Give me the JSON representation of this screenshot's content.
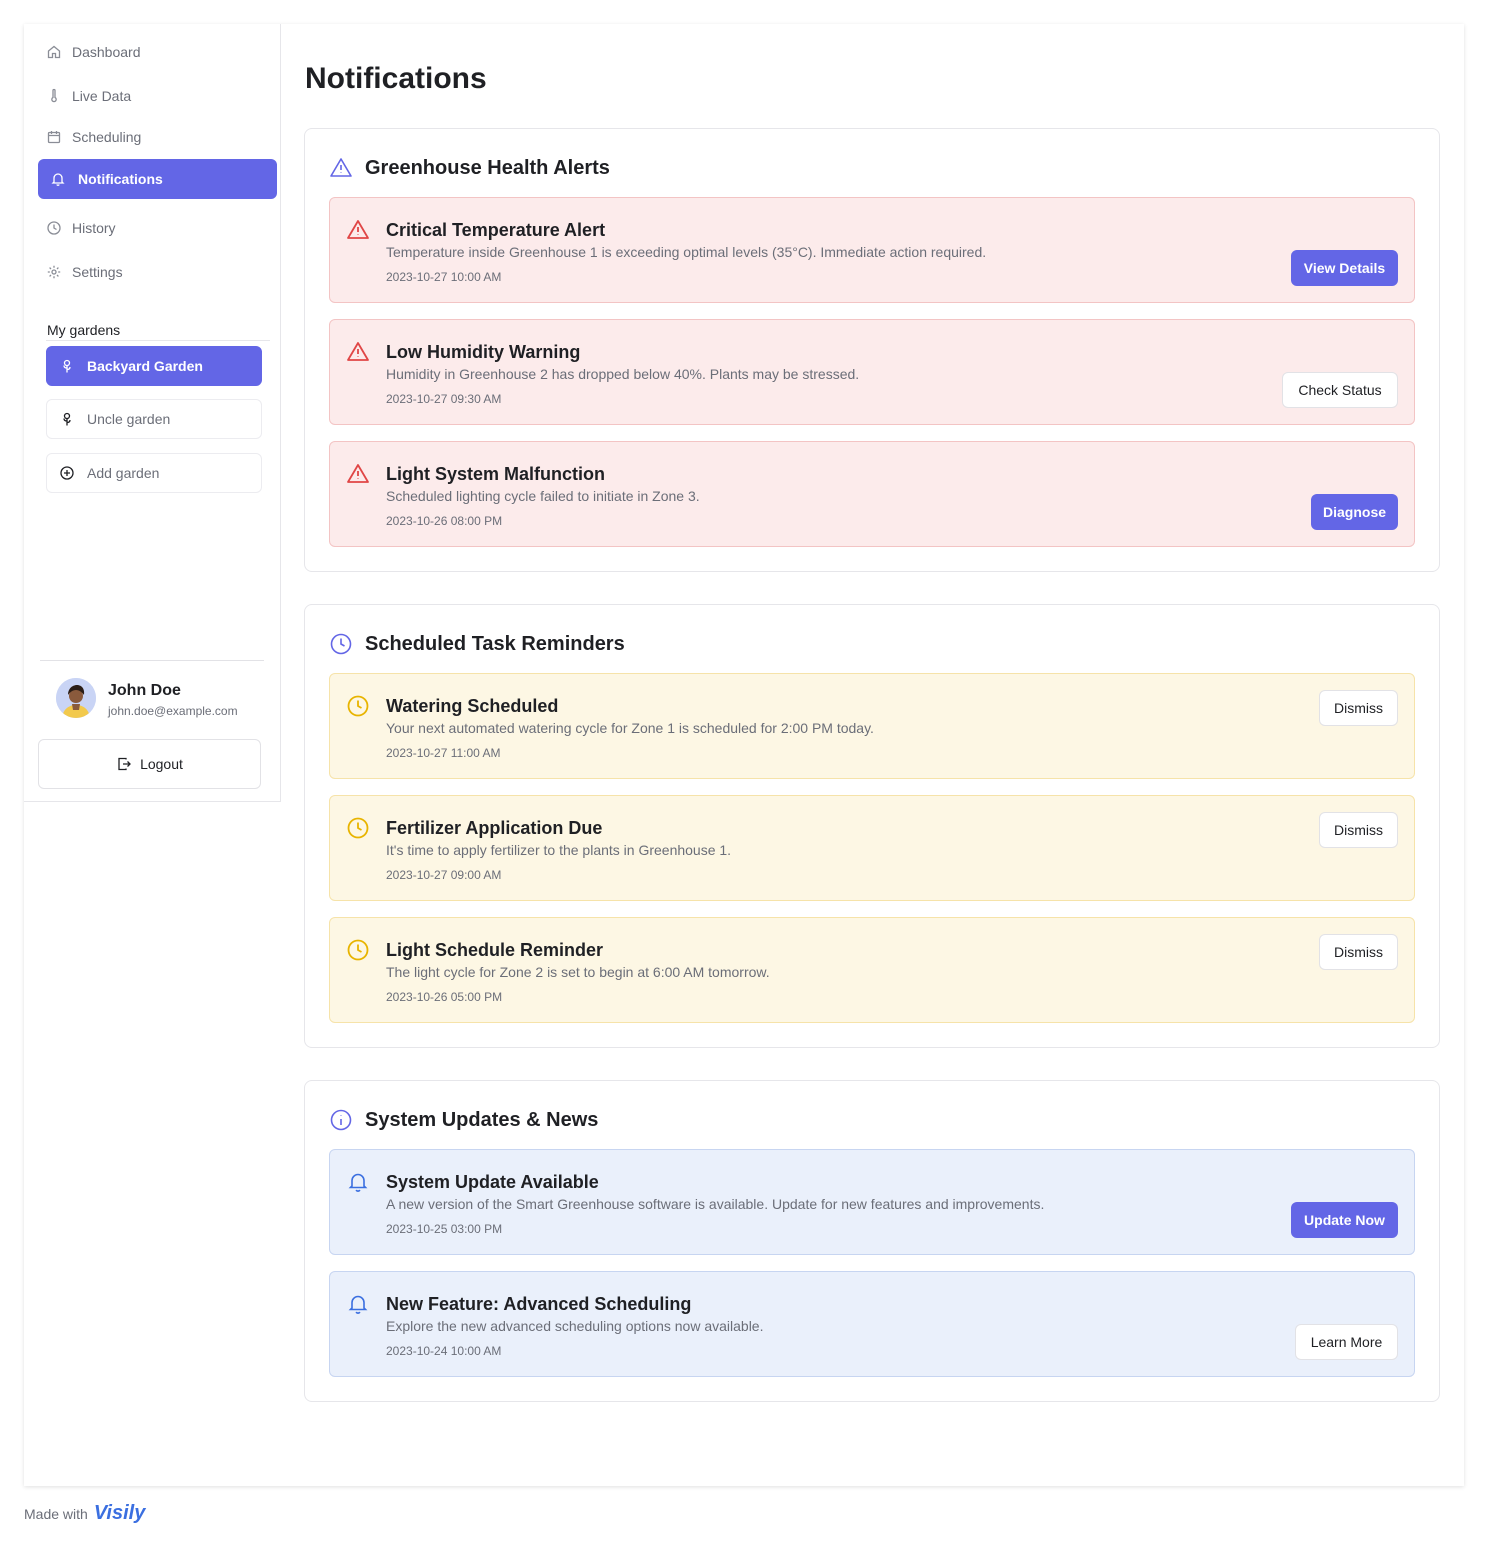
{
  "nav": {
    "dashboard": "Dashboard",
    "live_data": "Live Data",
    "scheduling": "Scheduling",
    "notifications": "Notifications",
    "history": "History",
    "settings": "Settings"
  },
  "gardens": {
    "label": "My gardens",
    "items": [
      "Backyard Garden",
      "Uncle garden"
    ],
    "add": "Add garden"
  },
  "user": {
    "name": "John Doe",
    "email": "john.doe@example.com",
    "logout": "Logout"
  },
  "page_title": "Notifications",
  "sections": [
    {
      "title": "Greenhouse Health Alerts",
      "items": [
        {
          "title": "Critical Temperature Alert",
          "desc": "Temperature inside Greenhouse 1 is exceeding optimal levels (35°C). Immediate action required.",
          "time": "2023-10-27 10:00 AM",
          "action": "View Details"
        },
        {
          "title": "Low Humidity Warning",
          "desc": "Humidity in Greenhouse 2 has dropped below 40%. Plants may be stressed.",
          "time": "2023-10-27 09:30 AM",
          "action": "Check Status"
        },
        {
          "title": "Light System Malfunction",
          "desc": "Scheduled lighting cycle failed to initiate in Zone 3.",
          "time": "2023-10-26 08:00 PM",
          "action": "Diagnose"
        }
      ]
    },
    {
      "title": "Scheduled Task Reminders",
      "items": [
        {
          "title": "Watering Scheduled",
          "desc": "Your next automated watering cycle for Zone 1 is scheduled for 2:00 PM today.",
          "time": "2023-10-27 11:00 AM",
          "action": "Dismiss"
        },
        {
          "title": "Fertilizer Application Due",
          "desc": "It's time to apply fertilizer to the plants in Greenhouse 1.",
          "time": "2023-10-27 09:00 AM",
          "action": "Dismiss"
        },
        {
          "title": "Light Schedule Reminder",
          "desc": "The light cycle for Zone 2 is set to begin at 6:00 AM tomorrow.",
          "time": "2023-10-26 05:00 PM",
          "action": "Dismiss"
        }
      ]
    },
    {
      "title": "System Updates & News",
      "items": [
        {
          "title": "System Update Available",
          "desc": "A new version of the Smart Greenhouse software is available. Update for new features and improvements.",
          "time": "2023-10-25 03:00 PM",
          "action": "Update Now"
        },
        {
          "title": "New Feature: Advanced Scheduling",
          "desc": "Explore the new advanced scheduling options now available.",
          "time": "2023-10-24 10:00 AM",
          "action": "Learn More"
        }
      ]
    }
  ],
  "footer": {
    "made_with": "Made with",
    "brand": "Visily"
  },
  "colors": {
    "accent": "#6366e6",
    "alert_red": "#e04646",
    "reminder_yellow": "#e8b400",
    "info_blue": "#3b6fe0"
  }
}
